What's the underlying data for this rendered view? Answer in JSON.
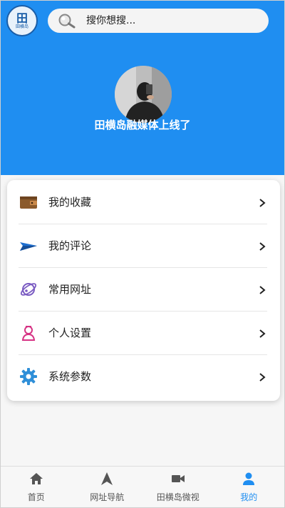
{
  "header": {
    "logo_text": "田横岛",
    "search_placeholder": "搜你想搜...",
    "username": "田横岛融媒体上线了"
  },
  "menu": {
    "items": [
      {
        "label": "我的收藏",
        "icon": "wallet-icon"
      },
      {
        "label": "我的评论",
        "icon": "paper-plane-icon"
      },
      {
        "label": "常用网址",
        "icon": "planet-icon"
      },
      {
        "label": "个人设置",
        "icon": "person-icon"
      },
      {
        "label": "系统参数",
        "icon": "gear-icon"
      }
    ]
  },
  "tabbar": {
    "tabs": [
      {
        "label": "首页",
        "icon": "home-icon"
      },
      {
        "label": "网址导航",
        "icon": "navigation-icon"
      },
      {
        "label": "田横岛微视",
        "icon": "video-icon"
      },
      {
        "label": "我的",
        "icon": "user-icon",
        "active": true
      }
    ]
  },
  "colors": {
    "primary": "#1f8ef1",
    "wallet": "#8b5a2b",
    "plane": "#1e6fd0",
    "planet": "#7a5bc2",
    "person": "#d63384",
    "gear": "#2f8fd8"
  }
}
